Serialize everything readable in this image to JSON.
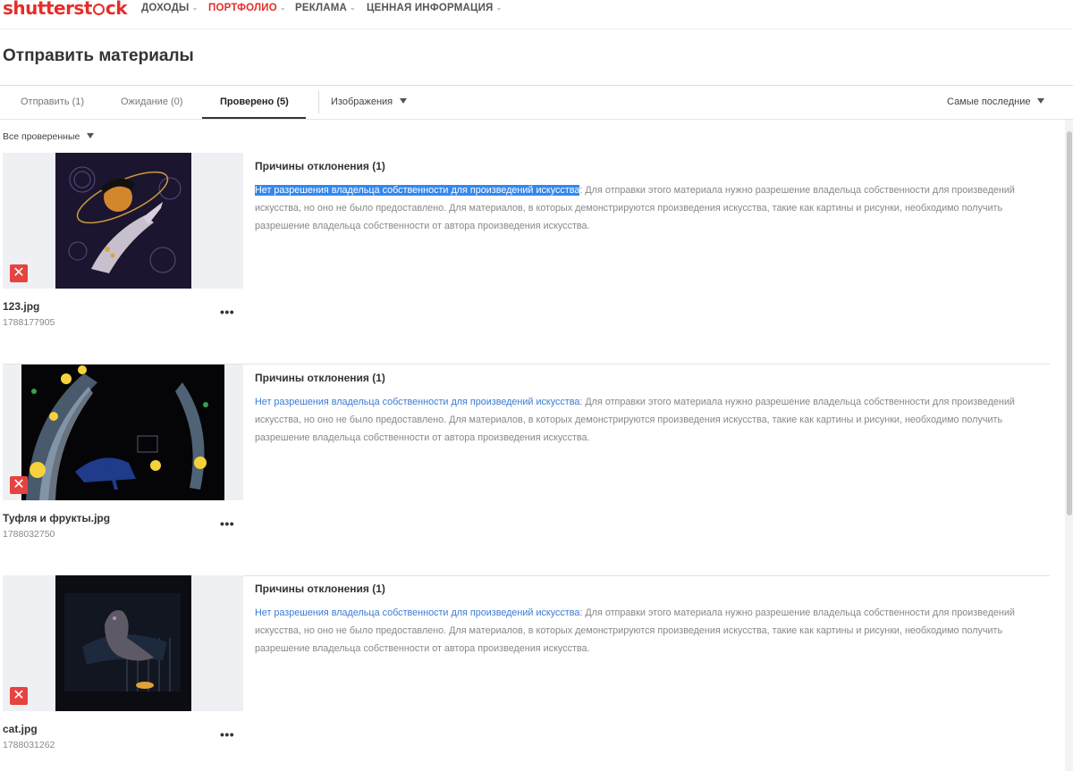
{
  "logo": {
    "pre": "shutterst",
    "post": "ck",
    "brand_color": "#e52e2a"
  },
  "nav": [
    {
      "label": "ДОХОДЫ"
    },
    {
      "label": "ПОРТФОЛИО"
    },
    {
      "label": "РЕКЛАМА"
    },
    {
      "label": "ЦЕННАЯ ИНФОРМАЦИЯ"
    }
  ],
  "page_title": "Отправить материалы",
  "tabs": [
    {
      "label": "Отправить (1)"
    },
    {
      "label": "Ожидание (0)"
    },
    {
      "label": "Проверено (5)"
    }
  ],
  "media_type_dropdown": "Изображения",
  "sort_dropdown": "Самые последние",
  "status_filter": "Все проверенные",
  "items": [
    {
      "filename": "123.jpg",
      "id": "1788177905",
      "reason_title": "Причины отклонения (1)",
      "reason_link": "Нет разрешения владельца собственности для произведений искусства",
      "reason_text": ": Для отправки этого материала нужно разрешение владельца собственности для произведений искусства, но оно не было предоставлено. Для материалов, в которых демонстрируются произведения искусства, такие как картины и рисунки, необходимо получить разрешение владельца собственности от автора произведения искусства."
    },
    {
      "filename": "Туфля и фрукты.jpg",
      "id": "1788032750",
      "reason_title": "Причины отклонения (1)",
      "reason_link": "Нет разрешения владельца собственности для произведений искусства",
      "reason_text": ": Для отправки этого материала нужно разрешение владельца собственности для произведений искусства, но оно не было предоставлено. Для материалов, в которых демонстрируются произведения искусства, такие как картины и рисунки, необходимо получить разрешение владельца собственности от автора произведения искусства."
    },
    {
      "filename": "cat.jpg",
      "id": "1788031262",
      "reason_title": "Причины отклонения (1)",
      "reason_link": "Нет разрешения владельца собственности для произведений искусства",
      "reason_text": ": Для отправки этого материала нужно разрешение владельца собственности для произведений искусства, но оно не было предоставлено. Для материалов, в которых демонстрируются произведения искусства, такие как картины и рисунки, необходимо получить разрешение владельца собственности от автора произведения искусства."
    }
  ],
  "more_glyph": "•••",
  "reject_glyph": "✕"
}
